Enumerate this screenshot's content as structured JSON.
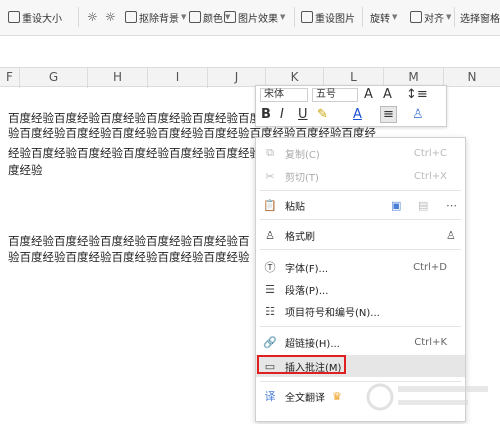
{
  "toolbar": {
    "reset_size": "重设大小",
    "remove_bg": "抠除背景",
    "color": "颜色",
    "picture_effects": "图片效果",
    "reset_picture": "重设图片",
    "rotate": "旋转",
    "align": "对齐",
    "select_pane": "选择窗格"
  },
  "columns": [
    "F",
    "G",
    "H",
    "I",
    "J",
    "K",
    "L",
    "M",
    "N"
  ],
  "document": {
    "para1": [
      "百度经验百度经验百度经验百度经验百度经验百度经验百",
      "验百度经验百度经验百度经验百度经验百度经验百度经验百度经验百度经",
      "经验百度经验百度经验百度经验百度经验百度经验百度经验百",
      "度经验"
    ],
    "para2": [
      "百度经验百度经验百度经验百度经验百度经验百",
      "验百度经验百度经验百度经验百度经验百度经验"
    ]
  },
  "mini_toolbar": {
    "font": "宋体",
    "size": "五号"
  },
  "context_menu": {
    "copy": {
      "label": "复制(C)",
      "shortcut": "Ctrl+C"
    },
    "cut": {
      "label": "剪切(T)",
      "shortcut": "Ctrl+X"
    },
    "paste": {
      "label": "粘贴"
    },
    "format_painter": {
      "label": "格式刷"
    },
    "font": {
      "label": "字体(F)...",
      "shortcut": "Ctrl+D"
    },
    "paragraph": {
      "label": "段落(P)..."
    },
    "numbering": {
      "label": "项目符号和编号(N)..."
    },
    "hyperlink": {
      "label": "超链接(H)...",
      "shortcut": "Ctrl+K"
    },
    "insert_comment": {
      "label": "插入批注(M)"
    },
    "translate": {
      "label": "全文翻译"
    }
  },
  "colors": {
    "highlight": "#e02020",
    "accent": "#4a7fd6"
  }
}
